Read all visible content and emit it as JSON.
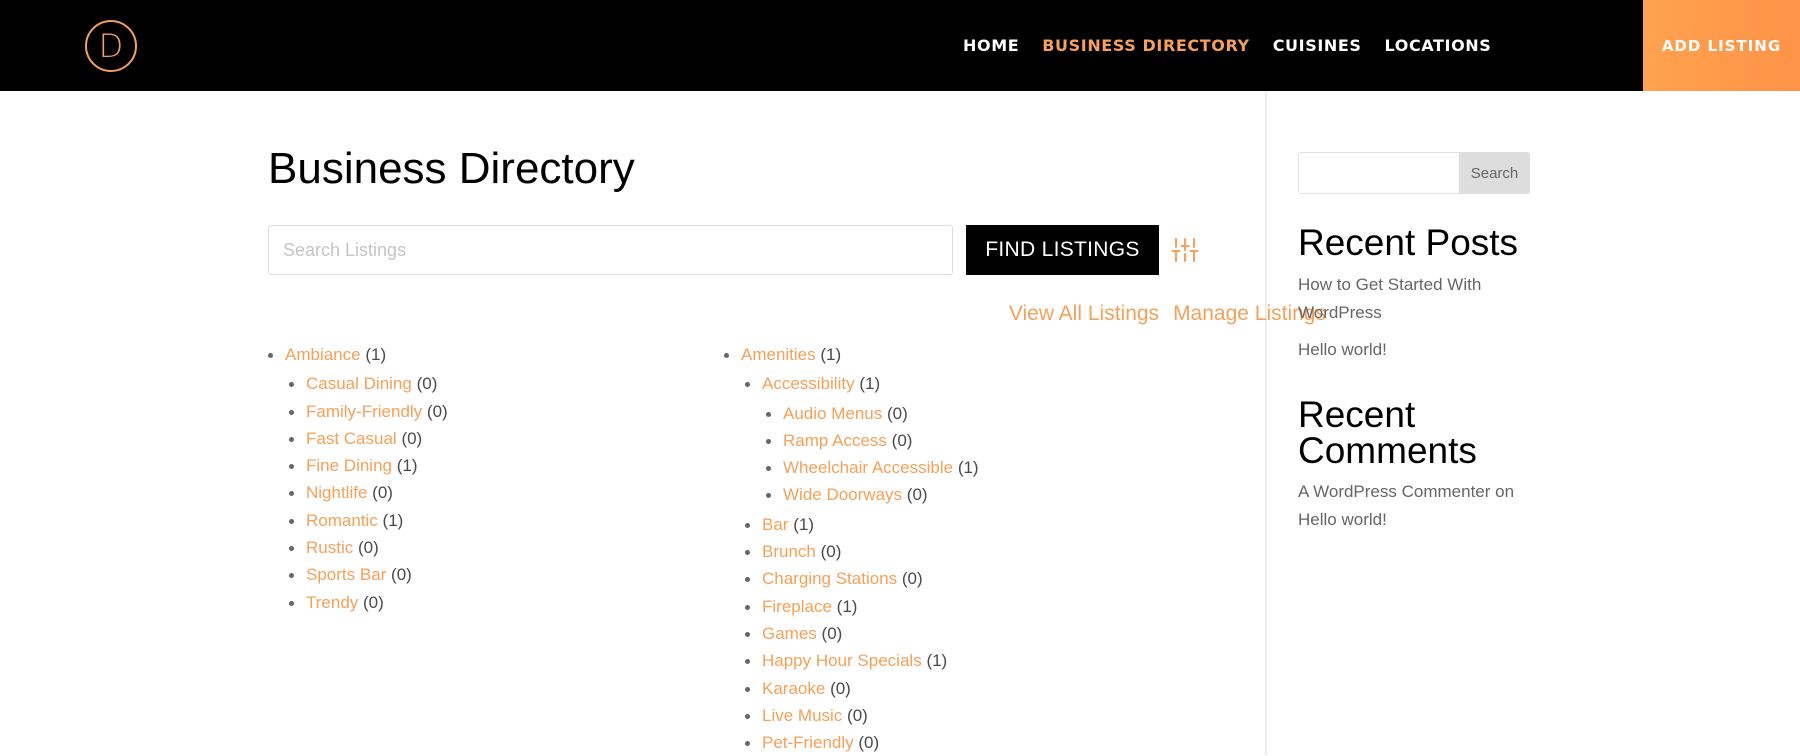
{
  "header": {
    "logo_letter": "D",
    "nav": [
      {
        "label": "HOME",
        "active": false
      },
      {
        "label": "BUSINESS DIRECTORY",
        "active": true
      },
      {
        "label": "CUISINES",
        "active": false
      },
      {
        "label": "LOCATIONS",
        "active": false
      }
    ],
    "add_listing_label": "ADD LISTING",
    "accent_color": "#f6a05a"
  },
  "main": {
    "title": "Business Directory",
    "search_placeholder": "Search Listings",
    "search_value": "",
    "find_button_label": "FIND LISTINGS",
    "filter_icon": "sliders-icon",
    "links": {
      "view_all": "View All Listings",
      "manage": "Manage Listings"
    },
    "categories_col1": {
      "name": "Ambiance",
      "count": "(1)",
      "children": [
        {
          "name": "Casual Dining",
          "count": "(0)"
        },
        {
          "name": "Family-Friendly",
          "count": "(0)"
        },
        {
          "name": "Fast Casual",
          "count": "(0)"
        },
        {
          "name": "Fine Dining",
          "count": "(1)"
        },
        {
          "name": "Nightlife",
          "count": "(0)"
        },
        {
          "name": "Romantic",
          "count": "(1)"
        },
        {
          "name": "Rustic",
          "count": "(0)"
        },
        {
          "name": "Sports Bar",
          "count": "(0)"
        },
        {
          "name": "Trendy",
          "count": "(0)"
        }
      ]
    },
    "categories_col2": {
      "name": "Amenities",
      "count": "(1)",
      "children": [
        {
          "name": "Accessibility",
          "count": "(1)",
          "children": [
            {
              "name": "Audio Menus",
              "count": "(0)"
            },
            {
              "name": "Ramp Access",
              "count": "(0)"
            },
            {
              "name": "Wheelchair Accessible",
              "count": "(1)"
            },
            {
              "name": "Wide Doorways",
              "count": "(0)"
            }
          ]
        },
        {
          "name": "Bar",
          "count": "(1)"
        },
        {
          "name": "Brunch",
          "count": "(0)"
        },
        {
          "name": "Charging Stations",
          "count": "(0)"
        },
        {
          "name": "Fireplace",
          "count": "(1)"
        },
        {
          "name": "Games",
          "count": "(0)"
        },
        {
          "name": "Happy Hour Specials",
          "count": "(1)"
        },
        {
          "name": "Karaoke",
          "count": "(0)"
        },
        {
          "name": "Live Music",
          "count": "(0)"
        },
        {
          "name": "Pet-Friendly",
          "count": "(0)"
        }
      ]
    }
  },
  "sidebar": {
    "search_button_label": "Search",
    "search_value": "",
    "recent_posts_title": "Recent Posts",
    "recent_posts": [
      "How to Get Started With WordPress",
      "Hello world!"
    ],
    "recent_comments_title": "Recent Comments",
    "recent_comment": {
      "author": "A WordPress Commenter",
      "on": "on",
      "post": "Hello world!"
    }
  }
}
